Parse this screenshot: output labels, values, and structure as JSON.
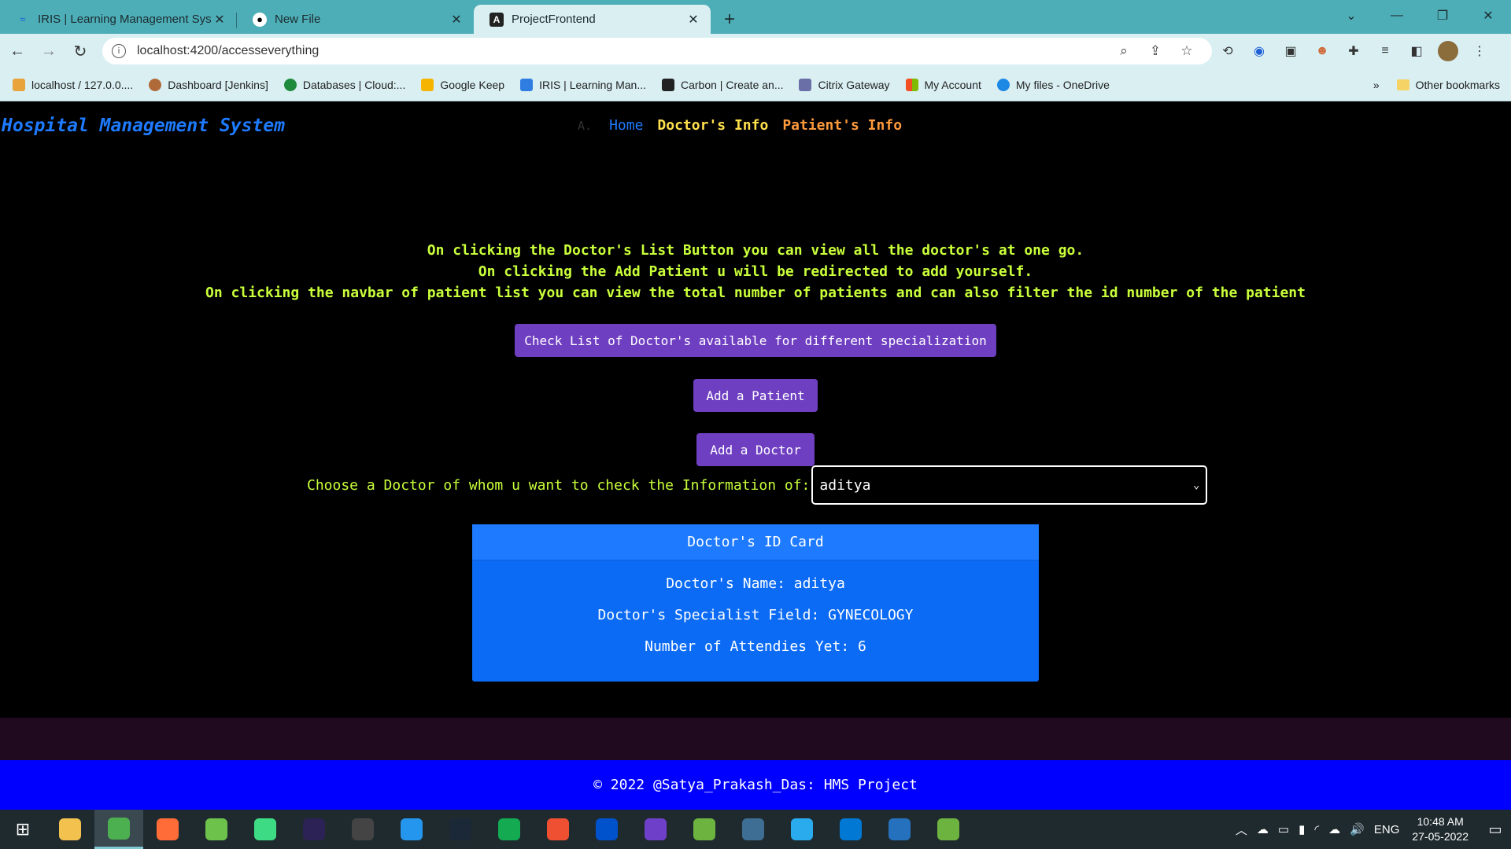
{
  "browser": {
    "tabs": [
      {
        "title": "IRIS | Learning Management Syst",
        "icon": "iris-icon",
        "active": false
      },
      {
        "title": "New File",
        "icon": "github-icon",
        "active": false
      },
      {
        "title": "ProjectFrontend",
        "icon": "angular-icon",
        "active": true
      }
    ],
    "url": "localhost:4200/accesseverything",
    "bookmarks": [
      {
        "label": "localhost / 127.0.0....",
        "color": "#e8a33a"
      },
      {
        "label": "Dashboard [Jenkins]",
        "color": "#b06a3a"
      },
      {
        "label": "Databases | Cloud:...",
        "color": "#1e8a3c"
      },
      {
        "label": "Google Keep",
        "color": "#f4b400"
      },
      {
        "label": "IRIS | Learning Man...",
        "color": "#2f7de1"
      },
      {
        "label": "Carbon | Create an...",
        "color": "#222222"
      },
      {
        "label": "Citrix Gateway",
        "color": "#6a6fa8"
      },
      {
        "label": "My Account",
        "color": "#f25022"
      },
      {
        "label": "My files - OneDrive",
        "color": "#1e88e5"
      }
    ],
    "bookmarks_more": "»",
    "other_bookmarks": "Other bookmarks"
  },
  "app": {
    "brand": "Hospital Management System",
    "nav": {
      "logo_text": "A.",
      "home": "Home",
      "doctors_info": "Doctor's Info",
      "patients_info": "Patient's Info"
    },
    "instructions": [
      "On clicking the Doctor's List Button you can view all the doctor's at one go.",
      "On clicking the Add Patient u will be redirected to add yourself.",
      "On clicking the navbar of patient list you can view the total number of patients and can also filter the id number of the patient"
    ],
    "buttons": {
      "check_list": "Check List of Doctor's available for different specialization",
      "add_patient": "Add a Patient",
      "add_doctor": "Add a Doctor"
    },
    "chooser": {
      "label": "Choose a Doctor of whom u want to check the Information of:",
      "selected": "aditya"
    },
    "card": {
      "title": "Doctor's ID Card",
      "name_line": "Doctor's Name: aditya",
      "field_line": "Doctor's Specialist Field: GYNECOLOGY",
      "attendies_line": "Number of Attendies Yet: 6"
    },
    "footer": "© 2022 @Satya_Prakash_Das: HMS Project"
  },
  "taskbar": {
    "apps": [
      {
        "name": "file-explorer",
        "color": "#f2c14e"
      },
      {
        "name": "chrome",
        "color": "#4caf50",
        "active": true
      },
      {
        "name": "postman",
        "color": "#ff6c37"
      },
      {
        "name": "nodejs",
        "color": "#6cc24a"
      },
      {
        "name": "android-studio",
        "color": "#3ddc84"
      },
      {
        "name": "eclipse",
        "color": "#2c2255"
      },
      {
        "name": "obs",
        "color": "#444444"
      },
      {
        "name": "docker",
        "color": "#2496ed"
      },
      {
        "name": "steam",
        "color": "#1b2838"
      },
      {
        "name": "mongodb-compass",
        "color": "#13aa52"
      },
      {
        "name": "git",
        "color": "#f05032"
      },
      {
        "name": "sourcetree",
        "color": "#0052cc"
      },
      {
        "name": "github-desktop",
        "color": "#6e40c9"
      },
      {
        "name": "spring-tools",
        "color": "#6db33f"
      },
      {
        "name": "mysql-workbench",
        "color": "#3e6e93"
      },
      {
        "name": "telegram",
        "color": "#2aabee"
      },
      {
        "name": "vscode",
        "color": "#0078d4"
      },
      {
        "name": "powershell",
        "color": "#2671be"
      },
      {
        "name": "spring-boot",
        "color": "#6db33f"
      }
    ],
    "lang": "ENG",
    "time": "10:48 AM",
    "date": "27-05-2022"
  }
}
